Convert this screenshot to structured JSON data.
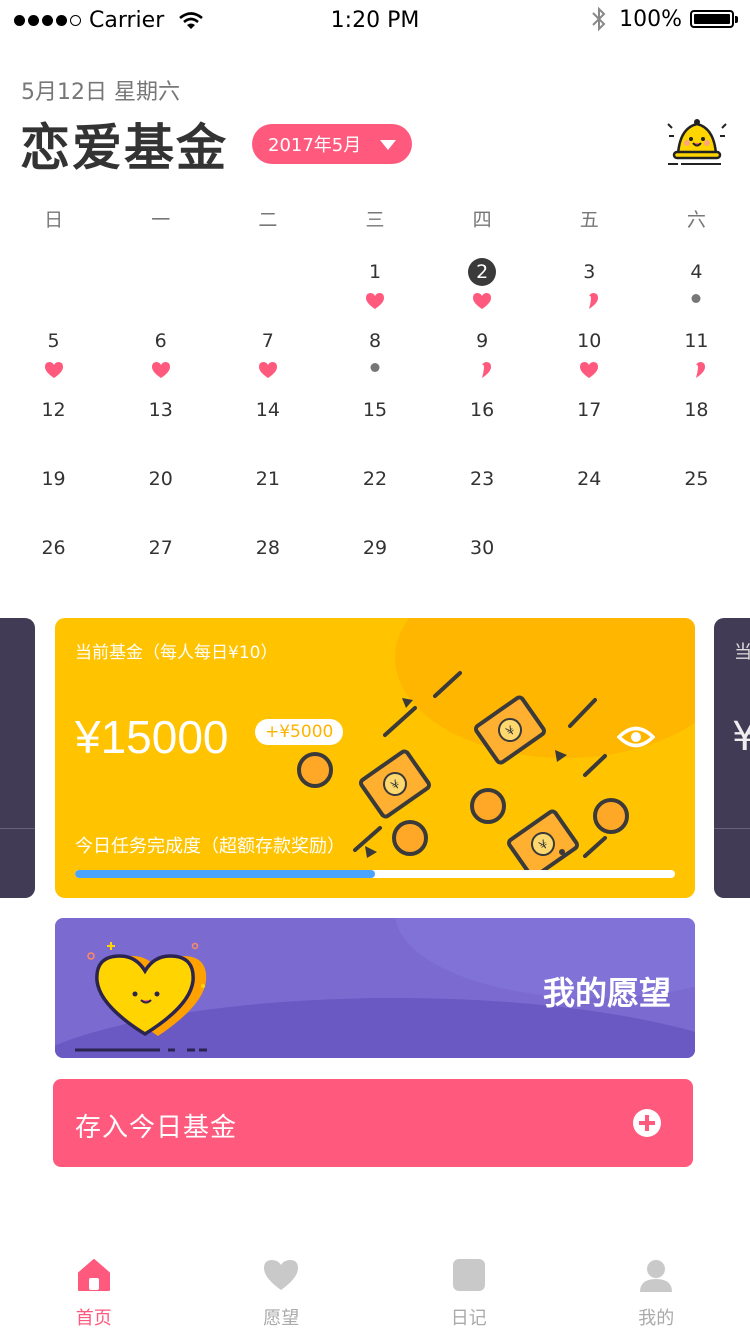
{
  "status_bar": {
    "carrier": "Carrier",
    "time": "1:20 PM",
    "battery": "100%"
  },
  "header": {
    "date_line": "5月12日 星期六",
    "title": "恋爱基金",
    "month_selector": "2017年5月"
  },
  "calendar": {
    "weekdays": [
      "日",
      "一",
      "二",
      "三",
      "四",
      "五",
      "六"
    ],
    "weeks": [
      [
        null,
        null,
        null,
        {
          "d": "1",
          "m": "heart"
        },
        {
          "d": "2",
          "m": "heart",
          "today": true
        },
        {
          "d": "3",
          "m": "half"
        },
        {
          "d": "4",
          "m": "dot"
        }
      ],
      [
        {
          "d": "5",
          "m": "heart"
        },
        {
          "d": "6",
          "m": "heart"
        },
        {
          "d": "7",
          "m": "heart"
        },
        {
          "d": "8",
          "m": "dot"
        },
        {
          "d": "9",
          "m": "half"
        },
        {
          "d": "10",
          "m": "heart"
        },
        {
          "d": "11",
          "m": "half"
        }
      ],
      [
        {
          "d": "12"
        },
        {
          "d": "13"
        },
        {
          "d": "14"
        },
        {
          "d": "15"
        },
        {
          "d": "16"
        },
        {
          "d": "17"
        },
        {
          "d": "18"
        }
      ],
      [
        {
          "d": "19"
        },
        {
          "d": "20"
        },
        {
          "d": "21"
        },
        {
          "d": "22"
        },
        {
          "d": "23"
        },
        {
          "d": "24"
        },
        {
          "d": "25"
        }
      ],
      [
        {
          "d": "26"
        },
        {
          "d": "27"
        },
        {
          "d": "28"
        },
        {
          "d": "29"
        },
        {
          "d": "30"
        },
        null,
        null
      ]
    ]
  },
  "fund_card": {
    "label": "当前基金（每人每日¥10）",
    "amount": "¥15000",
    "bonus": "+¥5000",
    "task_label": "今日任务完成度（超额存款奖励）",
    "progress_fraction": 0.5
  },
  "side_card_peek": {
    "label": "当",
    "amount": "¥"
  },
  "wish_card": {
    "title": "我的愿望"
  },
  "deposit_button": {
    "label": "存入今日基金"
  },
  "tabs": [
    {
      "label": "首页",
      "icon": "home-icon",
      "active": true
    },
    {
      "label": "愿望",
      "icon": "heart-icon",
      "active": false
    },
    {
      "label": "日记",
      "icon": "diary-icon",
      "active": false
    },
    {
      "label": "我的",
      "icon": "profile-icon",
      "active": false
    }
  ],
  "colors": {
    "accent": "#ff5a7e",
    "fund_card": "#ffc300",
    "wish_card": "#7b6bd1",
    "progress": "#4aa3ff",
    "dark_card": "#413b55"
  }
}
